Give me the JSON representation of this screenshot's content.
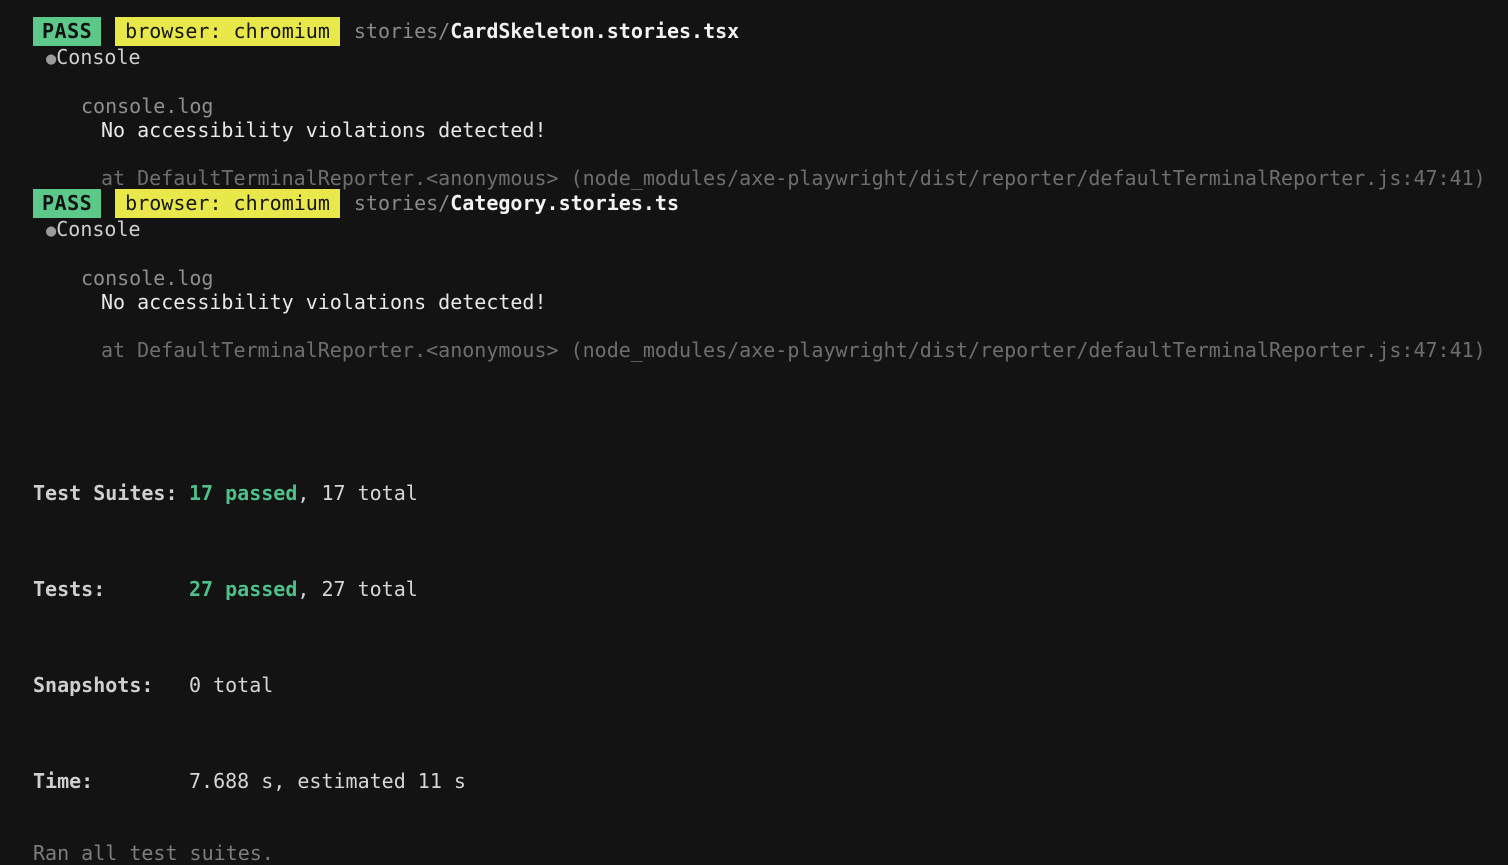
{
  "terminal": {
    "background_color": "#131313",
    "pass_badge_color": "#5cc98a",
    "browser_badge_color": "#e8e84a",
    "green_text_color": "#4ec08a"
  },
  "suites": [
    {
      "status": "PASS",
      "browser_tag": "browser: chromium",
      "path_dir": "stories/",
      "path_file": "CardSkeleton.stories.tsx",
      "console_bullet": "●",
      "console_title": "Console",
      "console_label": "console.log",
      "console_message": "No accessibility violations detected!",
      "stack_trace": "at DefaultTerminalReporter.<anonymous> (node_modules/axe-playwright/dist/reporter/defaultTerminalReporter.js:47:41)"
    },
    {
      "status": "PASS",
      "browser_tag": "browser: chromium",
      "path_dir": "stories/",
      "path_file": "Category.stories.ts",
      "console_bullet": "●",
      "console_title": "Console",
      "console_label": "console.log",
      "console_message": "No accessibility violations detected!",
      "stack_trace": "at DefaultTerminalReporter.<anonymous> (node_modules/axe-playwright/dist/reporter/defaultTerminalReporter.js:47:41)"
    }
  ],
  "summary": {
    "test_suites": {
      "label": "Test Suites:",
      "passed": "17 passed",
      "rest": ", 17 total"
    },
    "tests": {
      "label": "Tests:",
      "passed": "27 passed",
      "rest": ", 27 total"
    },
    "snapshots": {
      "label": "Snapshots:",
      "value": "0 total"
    },
    "time": {
      "label": "Time:",
      "value": "7.688 s, estimated 11 s"
    },
    "footer": "Ran all test suites."
  }
}
